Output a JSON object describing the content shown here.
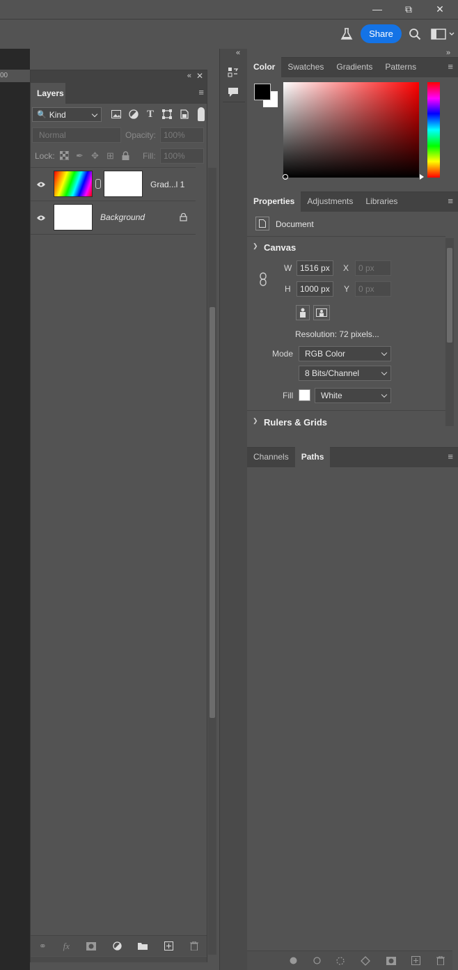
{
  "window": {
    "minimize_icon": "minimize-icon",
    "restore_icon": "restore-icon",
    "close_icon": "close-icon"
  },
  "optionsbar": {
    "share_label": "Share",
    "beaker_icon": "beaker-icon",
    "search_icon": "search-icon",
    "workspace_icon": "workspace-icon"
  },
  "ruler": {
    "tick_label": "00"
  },
  "layers": {
    "tab_label": "Layers",
    "filter_kind": "Kind",
    "blend_mode": "Normal",
    "opacity_label": "Opacity:",
    "opacity_value": "100%",
    "lock_label": "Lock:",
    "fill_label": "Fill:",
    "fill_value": "100%",
    "rows": [
      {
        "name": "Grad...l 1",
        "visible": true,
        "type": "gradient-fill"
      },
      {
        "name": "Background",
        "visible": true,
        "locked": true
      }
    ],
    "bottom_icons": [
      "link-icon",
      "fx-icon",
      "mask-icon",
      "adjustment-icon",
      "folder-icon",
      "new-layer-icon",
      "trash-icon"
    ]
  },
  "color_panel": {
    "tabs": [
      "Color",
      "Swatches",
      "Gradients",
      "Patterns"
    ],
    "active_tab": "Color",
    "foreground": "#000000",
    "background": "#ffffff",
    "hue": "#ff0000"
  },
  "properties": {
    "tabs": [
      "Properties",
      "Adjustments",
      "Libraries"
    ],
    "active_tab": "Properties",
    "document_label": "Document",
    "canvas_title": "Canvas",
    "w_label": "W",
    "w_value": "1516 px",
    "h_label": "H",
    "h_value": "1000 px",
    "x_label": "X",
    "x_value": "0 px",
    "y_label": "Y",
    "y_value": "0 px",
    "resolution": "Resolution: 72 pixels...",
    "mode_label": "Mode",
    "mode_value": "RGB Color",
    "bits_value": "8 Bits/Channel",
    "fill_label": "Fill",
    "fill_value": "White",
    "rulers_title": "Rulers & Grids"
  },
  "channels_panel": {
    "tabs": [
      "Channels",
      "Paths"
    ],
    "active_tab": "Paths",
    "bottom_icons": [
      "fill-path-icon",
      "stroke-path-icon",
      "selection-icon",
      "work-path-icon",
      "mask-icon",
      "new-path-icon",
      "trash-icon"
    ]
  }
}
